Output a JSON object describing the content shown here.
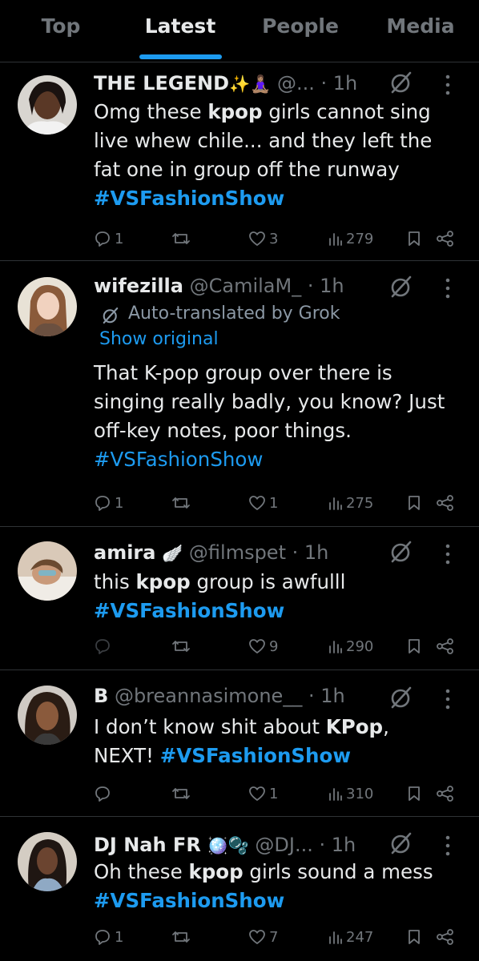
{
  "tabs": [
    {
      "label": "Top"
    },
    {
      "label": "Latest"
    },
    {
      "label": "People"
    },
    {
      "label": "Media"
    }
  ],
  "active_tab": "Latest",
  "colors": {
    "accent": "#1d9bf0",
    "muted": "#71767b",
    "text": "#e7e9ea",
    "divider": "#2f3336"
  },
  "tweets": [
    {
      "name": "THE LEGEND",
      "name_emoji": "✨🧘🏽‍♀️",
      "handle": "@...",
      "time": "· 1h",
      "text_before": "Omg these ",
      "text_bold": "kpop",
      "text_after": " girls cannot sing live whew chile... and they left the fat one in group off the runway",
      "hashtag": "#VSFashionShow",
      "replies": "1",
      "reposts": "",
      "likes": "3",
      "views": "279"
    },
    {
      "name": "wifezilla",
      "handle": "@CamilaM_",
      "time": "· 1h",
      "translated_label": "Auto-translated by Grok",
      "show_original": "Show original",
      "text": "That K-pop group over there is singing really badly, you know? Just off-key notes, poor things.",
      "hashtag": "#VSFashionShow",
      "replies": "1",
      "reposts": "",
      "likes": "1",
      "views": "275"
    },
    {
      "name": "amira",
      "name_emoji": "🪽",
      "handle": "@filmspet",
      "time": "· 1h",
      "text_before": "this ",
      "text_bold": "kpop",
      "text_after": " group is awfulll",
      "hashtag": "#VSFashionShow",
      "replies": "",
      "reposts": "",
      "likes": "9",
      "views": "290"
    },
    {
      "name": "B",
      "handle": "@breannasimone__",
      "time": "· 1h",
      "text_before": "I don’t know shit about ",
      "text_bold": "KPop",
      "text_after": ", NEXT! ",
      "hashtag": "#VSFashionShow",
      "replies": "",
      "reposts": "",
      "likes": "1",
      "views": "310"
    },
    {
      "name": "DJ Nah FR",
      "name_emoji": "🪩🫧",
      "handle": "@DJ...",
      "time": "· 1h",
      "text_before": "Oh these ",
      "text_bold": "kpop",
      "text_after": " girls sound a mess",
      "hashtag": "#VSFashionShow",
      "replies": "1",
      "reposts": "",
      "likes": "7",
      "views": "247"
    }
  ]
}
